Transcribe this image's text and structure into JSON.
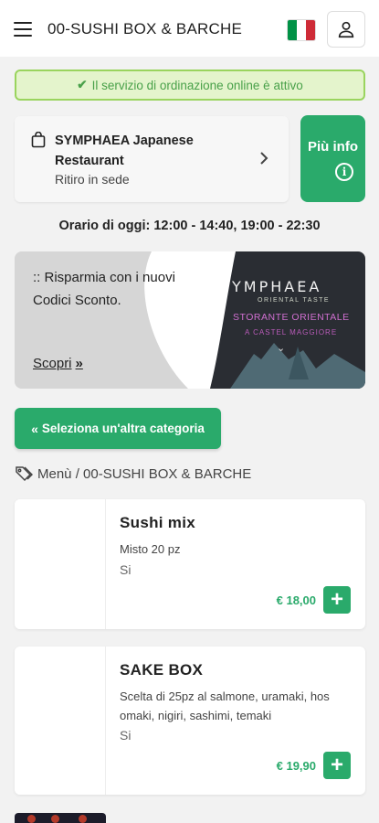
{
  "header": {
    "title": "00-SUSHI BOX & BARCHE",
    "flag_colors": [
      "#009246",
      "#ffffff",
      "#ce2b37"
    ]
  },
  "status_banner": {
    "text": "Il servizio di ordinazione online è attivo",
    "icon": "check-icon"
  },
  "restaurant": {
    "name": "SYMPHAEA Japanese Restaurant",
    "service": "Ritiro in sede",
    "icon": "shopping-bag-icon"
  },
  "info_button": {
    "label": "Più info",
    "icon": "info-icon"
  },
  "hours": "Orario di oggi: 12:00 - 14:40, 19:00 - 22:30",
  "promo": {
    "text": ":: Risparmia con i nuovi Codici Sconto.",
    "link": "Scopri",
    "brand_name": "YMPHAEA",
    "brand_tagline": "ORIENTAL TASTE",
    "brand_line1": "STORANTE ORIENTALE",
    "brand_line2": "A CASTEL MAGGIORE"
  },
  "category_button": {
    "label": "Seleziona un'altra categoria"
  },
  "breadcrumb": "Menù / 00-SUSHI BOX & BARCHE",
  "products": [
    {
      "name": "Sushi mix",
      "description": "Misto 20 pz",
      "availability": "Si",
      "price": "€ 18,00"
    },
    {
      "name": "SAKE BOX",
      "description": "Scelta di 25pz al salmone, uramaki, hos omaki, nigiri, sashimi, temaki",
      "availability": "Si",
      "price": "€ 19,90"
    }
  ],
  "colors": {
    "accent": "#2aaa6b",
    "banner_bg": "#e4f4cc",
    "banner_border": "#9ad45e"
  }
}
